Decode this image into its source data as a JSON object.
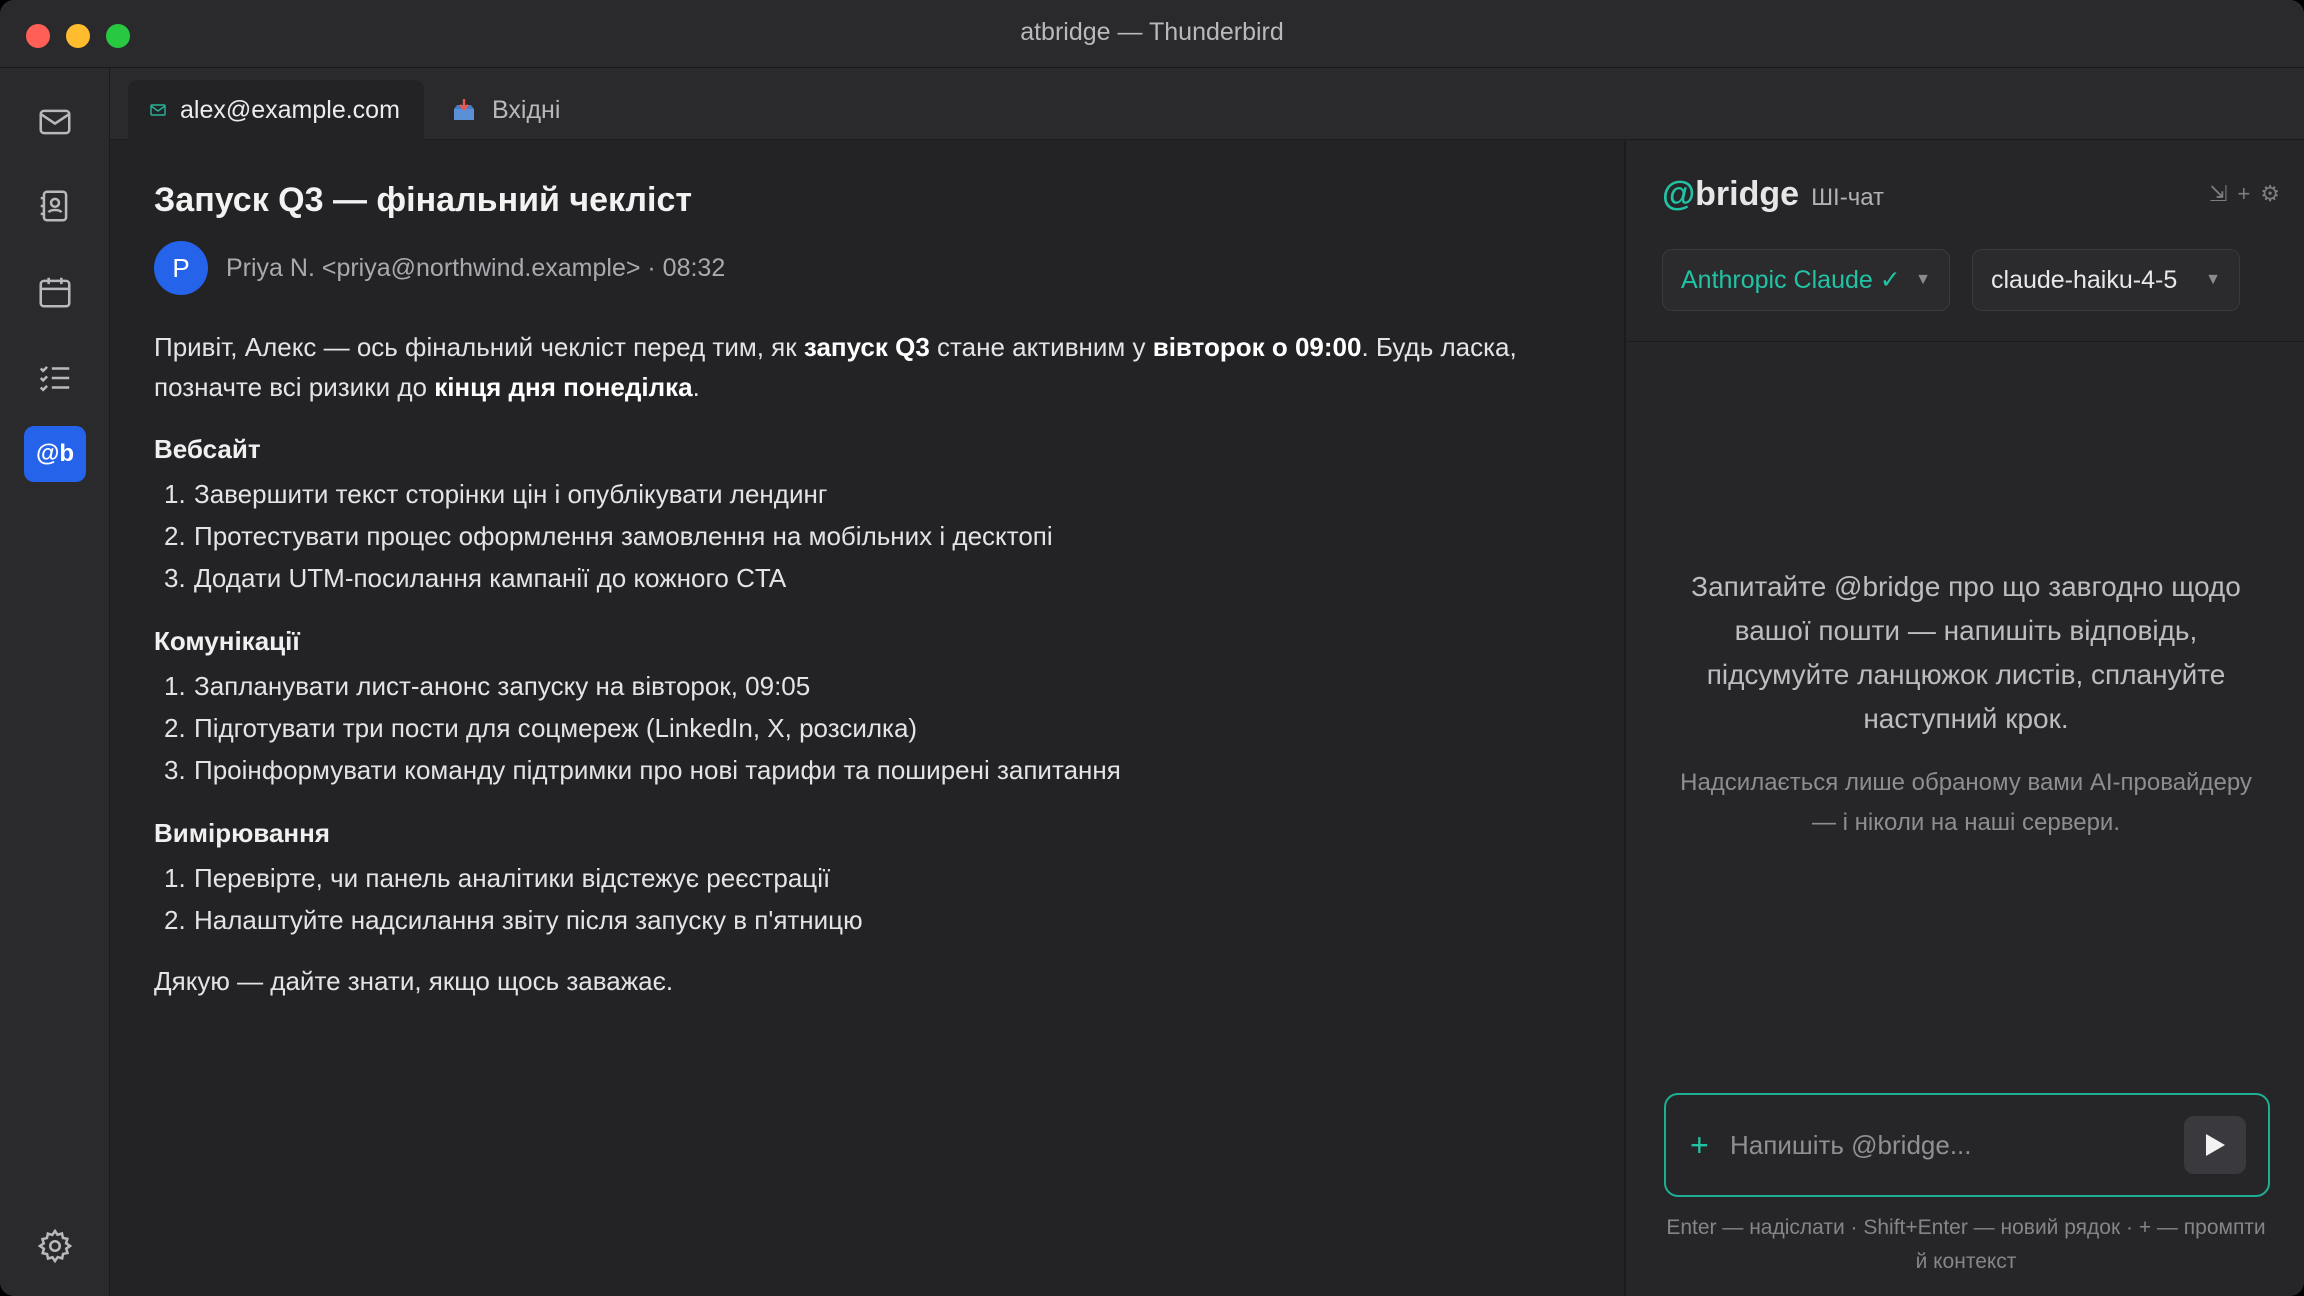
{
  "window": {
    "title": "atbridge — Thunderbird"
  },
  "tabs": [
    {
      "label": "alex@example.com",
      "icon": "mail-icon"
    },
    {
      "label": "Вхідні",
      "icon": "inbox-icon"
    }
  ],
  "rail": {
    "items": [
      "mail-icon",
      "address-book-icon",
      "calendar-icon",
      "tasks-icon",
      "atbridge-icon"
    ],
    "atbridge_label": "@b",
    "settings": "gear-icon"
  },
  "email": {
    "subject": "Запуск Q3 — фінальний чекліст",
    "avatar_letter": "P",
    "sender": "Priya N. <priya@northwind.example> · 08:32",
    "intro": {
      "t1": "Привіт, Алекс — ось фінальний чекліст перед тим, як ",
      "b1": "запуск Q3",
      "t2": " стане активним у ",
      "b2": "вівторок о 09:00",
      "t3": ". Будь ласка, позначте всі ризики до ",
      "b3": "кінця дня понеділка",
      "t4": "."
    },
    "sections": [
      {
        "title": "Вебсайт",
        "items": [
          "Завершити текст сторінки цін і опублікувати лендинг",
          "Протестувати процес оформлення замовлення на мобільних і десктопі",
          "Додати UTM-посилання кампанії до кожного CTA"
        ]
      },
      {
        "title": "Комунікації",
        "items": [
          "Запланувати лист-анонс запуску на вівторок, 09:05",
          "Підготувати три пости для соцмереж (LinkedIn, X, розсилка)",
          "Проінформувати команду підтримки про нові тарифи та поширені запитання"
        ]
      },
      {
        "title": "Вимірювання",
        "items": [
          "Перевірте, чи панель аналітики відстежує реєстрації",
          "Налаштуйте надсилання звіту після запуску в п'ятницю"
        ]
      }
    ],
    "closing": "Дякую — дайте знати, якщо щось заважає."
  },
  "chat": {
    "brand_at": "@",
    "brand_name": "bridge",
    "subtitle": "ШІ-чат",
    "provider": "Anthropic Claude ✓",
    "model": "claude-haiku-4-5",
    "empty_main": "Запитайте @bridge про що завгодно щодо вашої пошти — напишіть відповідь, підсумуйте ланцюжок листів, сплануйте наступний крок.",
    "empty_note": "Надсилається лише обраному вами AI-провайдеру — і ніколи на наші сервери.",
    "composer_placeholder": "Напишіть @bridge...",
    "hint": "Enter — надіслати · Shift+Enter — новий рядок · + — промпти й контекст"
  },
  "colors": {
    "accent": "#22c3a5",
    "brand_blue": "#2563eb",
    "background": "#232326"
  }
}
